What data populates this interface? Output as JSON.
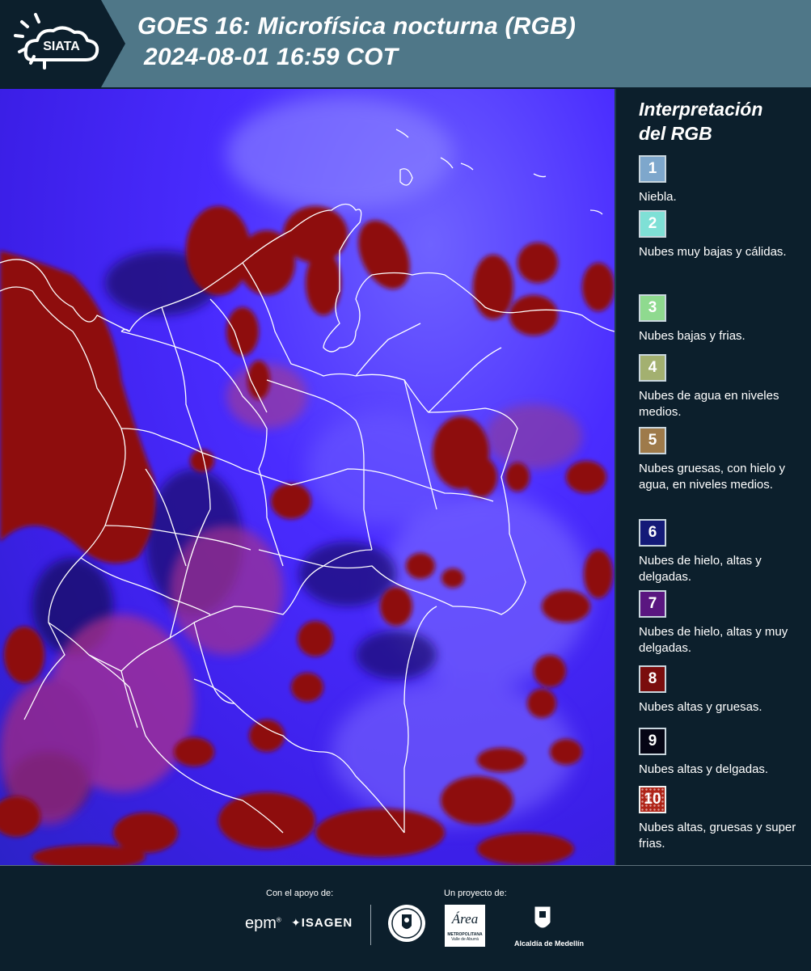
{
  "header": {
    "logo_text": "SIATA",
    "title_line1": "GOES 16: Microfísica nocturna (RGB)",
    "title_line2": "2024-08-01 16:59 COT",
    "band_color": "#4f7788",
    "logo_band_color": "#0c1f2c"
  },
  "legend": {
    "title_line1": "Interpretación",
    "title_line2": "del RGB",
    "items": [
      {
        "num": "1",
        "label": "Niebla.",
        "color": "#7ea7cc"
      },
      {
        "num": "2",
        "label": "Nubes muy bajas y cálidas.",
        "color": "#7fe0d6"
      },
      {
        "num": "3",
        "label": "Nubes bajas y frias.",
        "color": "#8fda8f"
      },
      {
        "num": "4",
        "label": "Nubes de agua en niveles medios.",
        "color": "#a3b070"
      },
      {
        "num": "5",
        "label": "Nubes gruesas, con hielo y agua, en niveles medios.",
        "color": "#9e7a4a"
      },
      {
        "num": "6",
        "label": "Nubes de hielo, altas y delgadas.",
        "color": "#141a78"
      },
      {
        "num": "7",
        "label": "Nubes de hielo, altas y muy delgadas.",
        "color": "#5a1680"
      },
      {
        "num": "8",
        "label": "Nubes altas y gruesas.",
        "color": "#7a0d0d"
      },
      {
        "num": "9",
        "label": "Nubes altas y delgadas.",
        "color": "#050514"
      },
      {
        "num": "10",
        "label": "Nubes altas, gruesas y super frias.",
        "color": "#b02418"
      }
    ]
  },
  "footer": {
    "support_caption": "Con el apoyo de:",
    "project_caption": "Un proyecto de:",
    "sponsors": [
      "epm",
      "ISAGEN"
    ],
    "partners": {
      "area_word": "Área",
      "area_sub1": "METROPOLITANA",
      "area_sub2": "Valle de Aburrá",
      "alcaldia": "Alcaldía de Medellín"
    }
  },
  "colors": {
    "footer_bg": "#0c1f2c",
    "cloud_red": "#8e0f0f",
    "sky_blue": "#4a2cff",
    "border_white": "#ffffff"
  }
}
